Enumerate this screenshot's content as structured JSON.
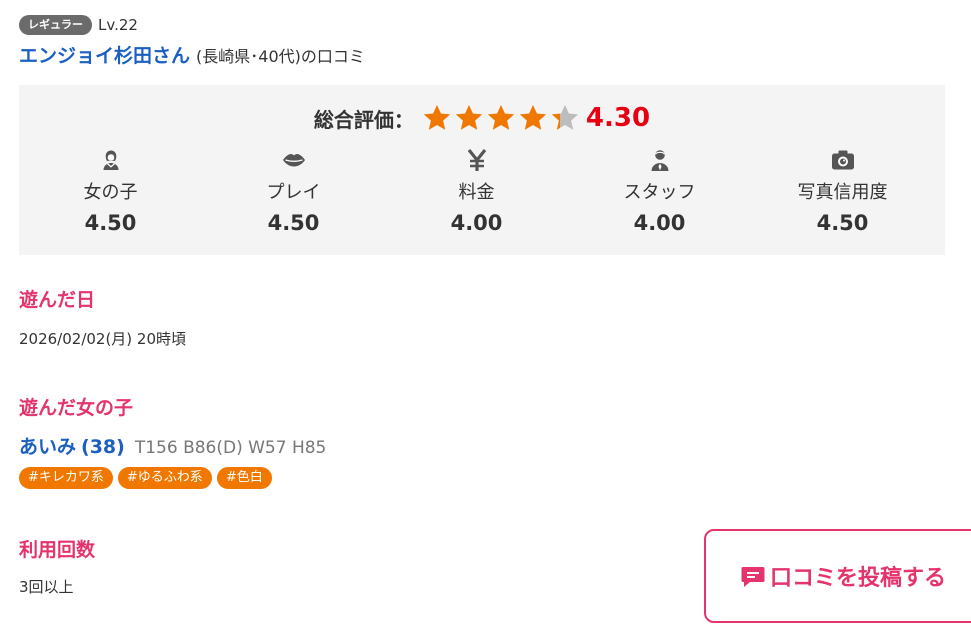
{
  "reviewer": {
    "rank": "レギュラー",
    "level": "Lv.22",
    "name": "エンジョイ杉田さん",
    "meta": "(長崎県･40代)の口コミ"
  },
  "rating": {
    "overall_label": "総合評価：",
    "overall_score": "4.30",
    "overall_value": 4.3,
    "star_max": 5,
    "colors": {
      "star_on": "#f07800",
      "star_off": "#bdbdbd",
      "score": "#e60012"
    },
    "categories": [
      {
        "icon": "girl-icon",
        "label": "女の子",
        "score": "4.50"
      },
      {
        "icon": "lips-icon",
        "label": "プレイ",
        "score": "4.50"
      },
      {
        "icon": "yen-icon",
        "label": "料金",
        "score": "4.00"
      },
      {
        "icon": "staff-icon",
        "label": "スタッフ",
        "score": "4.00"
      },
      {
        "icon": "camera-icon",
        "label": "写真信用度",
        "score": "4.50"
      }
    ]
  },
  "visit": {
    "heading": "遊んだ日",
    "date": "2026/02/02(月) 20時頃"
  },
  "girl": {
    "heading": "遊んだ女の子",
    "name": "あいみ",
    "age": "(38)",
    "size": "T156 B86(D) W57 H85",
    "tags": [
      "#キレカワ系",
      "#ゆるふわ系",
      "#色白"
    ]
  },
  "usage": {
    "heading": "利用回数",
    "count": "3回以上"
  },
  "post_button": {
    "icon": "comment-icon",
    "label": "口コミを投稿する"
  }
}
